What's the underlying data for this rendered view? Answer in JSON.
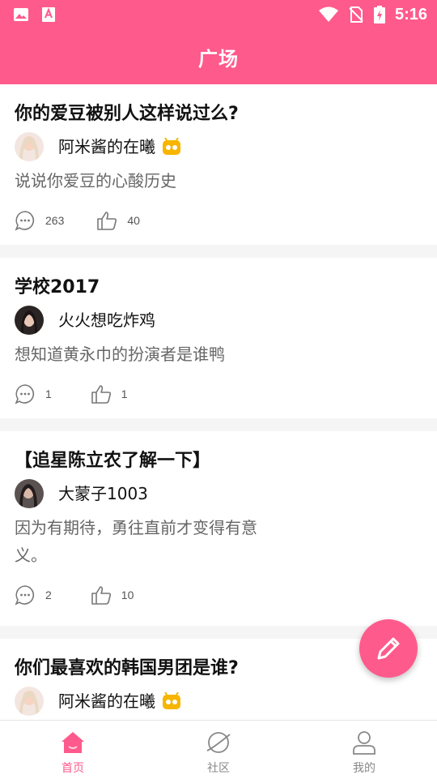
{
  "status_bar": {
    "time": "5:16",
    "icons": [
      "image-icon",
      "app-a-icon",
      "wifi-icon",
      "no-sim-icon",
      "battery-charging-icon"
    ]
  },
  "app_bar": {
    "title": "广场"
  },
  "posts": [
    {
      "title": "你的爱豆被别人这样说过么?",
      "author": "阿米酱的在曦",
      "has_badge": true,
      "body": "说说你爱豆的心酸历史",
      "comments": "263",
      "likes": "40"
    },
    {
      "title": "学校2017",
      "author": "火火想吃炸鸡",
      "has_badge": false,
      "body": "想知道黄永巾的扮演者是谁鸭",
      "comments": "1",
      "likes": "1"
    },
    {
      "title": "【追星陈立农了解一下】",
      "author": "大蒙子1003",
      "has_badge": false,
      "body": "因为有期待，勇往直前才变得有意义。",
      "comments": "2",
      "likes": "10"
    },
    {
      "title": "你们最喜欢的韩国男团是谁?",
      "author": "阿米酱的在曦",
      "has_badge": true,
      "body": "",
      "comments": "",
      "likes": ""
    }
  ],
  "fab": {
    "icon": "pencil-icon"
  },
  "tabs": [
    {
      "label": "首页",
      "icon": "home-icon",
      "active": true
    },
    {
      "label": "社区",
      "icon": "planet-icon",
      "active": false
    },
    {
      "label": "我的",
      "icon": "user-icon",
      "active": false
    }
  ],
  "colors": {
    "accent": "#ff5a8c",
    "badge": "#f7b500"
  }
}
